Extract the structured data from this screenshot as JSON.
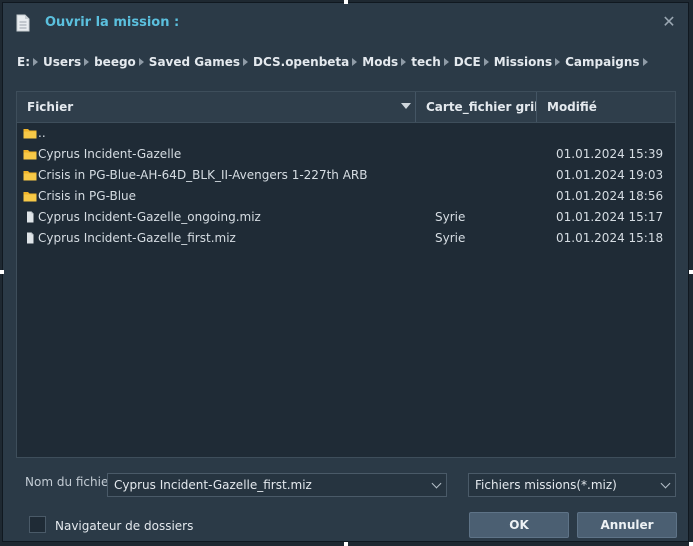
{
  "title": "Ouvrir la mission :",
  "breadcrumb": [
    "E:",
    "Users",
    "beego",
    "Saved Games",
    "DCS.openbeta",
    "Mods",
    "tech",
    "DCE",
    "Missions",
    "Campaigns"
  ],
  "columns": {
    "name": "Fichier",
    "map": "Carte_fichier grille",
    "modified": "Modifié"
  },
  "rows": [
    {
      "type": "folder",
      "name": "..",
      "map": "",
      "date": ""
    },
    {
      "type": "folder",
      "name": "Cyprus Incident-Gazelle",
      "map": "",
      "date": "01.01.2024 15:39"
    },
    {
      "type": "folder",
      "name": "Crisis in PG-Blue-AH-64D_BLK_II-Avengers 1-227th ARB",
      "map": "",
      "date": "01.01.2024 19:03"
    },
    {
      "type": "folder",
      "name": "Crisis in PG-Blue",
      "map": "",
      "date": "01.01.2024 18:56"
    },
    {
      "type": "file",
      "name": "Cyprus Incident-Gazelle_ongoing.miz",
      "map": "Syrie",
      "date": "01.01.2024 15:17"
    },
    {
      "type": "file",
      "name": "Cyprus Incident-Gazelle_first.miz",
      "map": "Syrie",
      "date": "01.01.2024 15:18"
    }
  ],
  "filename": {
    "label": "Nom du fichie",
    "value": "Cyprus Incident-Gazelle_first.miz"
  },
  "filter": {
    "selected": "Fichiers missions(*.miz)"
  },
  "folder_browser": {
    "label": "Navigateur de dossiers",
    "checked": false
  },
  "buttons": {
    "ok": "OK",
    "cancel": "Annuler"
  },
  "colors": {
    "accent": "#5bc0de",
    "folder": "#f0b429",
    "background": "#2b3a47"
  },
  "icons": {
    "title": "document-icon",
    "folder": "folder-icon",
    "file": "file-icon",
    "close": "close-icon"
  }
}
